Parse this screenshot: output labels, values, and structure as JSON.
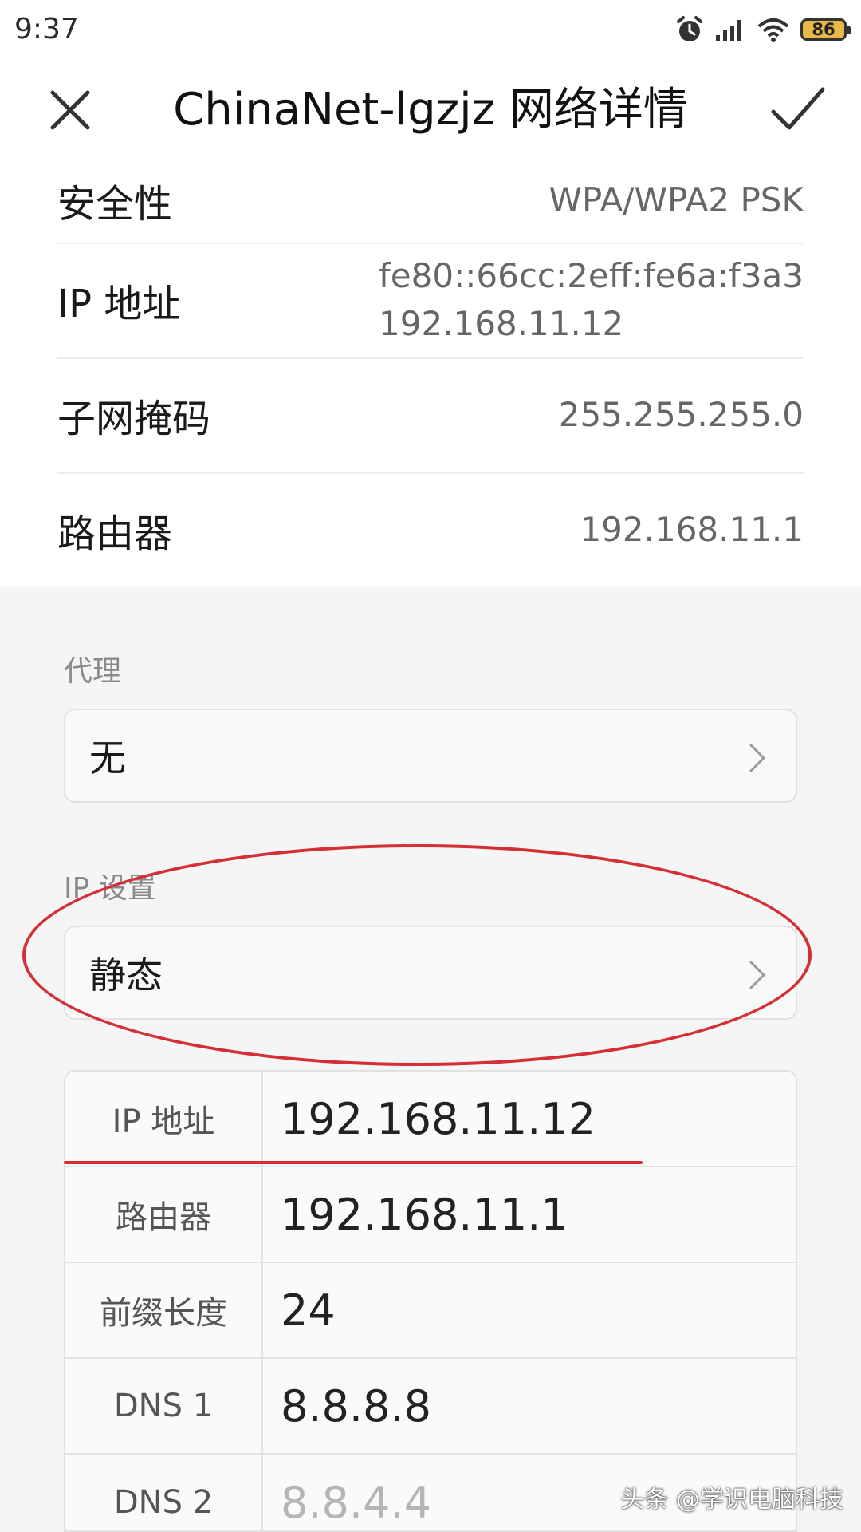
{
  "status_bar": {
    "time": "9:37",
    "battery_level": "86"
  },
  "header": {
    "title": "ChinaNet-lgzjz  网络详情"
  },
  "info": [
    {
      "label": "安全性",
      "value": "WPA/WPA2 PSK"
    },
    {
      "label": "IP 地址",
      "value_lines": [
        "fe80::66cc:2eff:fe6a:f3a3",
        "192.168.11.12"
      ]
    },
    {
      "label": "子网掩码",
      "value": "255.255.255.0"
    },
    {
      "label": "路由器",
      "value": "192.168.11.1"
    }
  ],
  "proxy": {
    "section_label": "代理",
    "selected": "无"
  },
  "ip_settings": {
    "section_label": "IP 设置",
    "selected": "静态"
  },
  "static_fields": [
    {
      "label": "IP 地址",
      "value": "192.168.11.12"
    },
    {
      "label": "路由器",
      "value": "192.168.11.1"
    },
    {
      "label": "前缀长度",
      "value": "24"
    },
    {
      "label": "DNS 1",
      "value": "8.8.8.8"
    },
    {
      "label": "DNS 2",
      "placeholder": "8.8.4.4"
    }
  ],
  "watermark": "头条 @学识电脑科技",
  "colors": {
    "annotation": "#d32f35",
    "battery": "#e8b84a"
  }
}
